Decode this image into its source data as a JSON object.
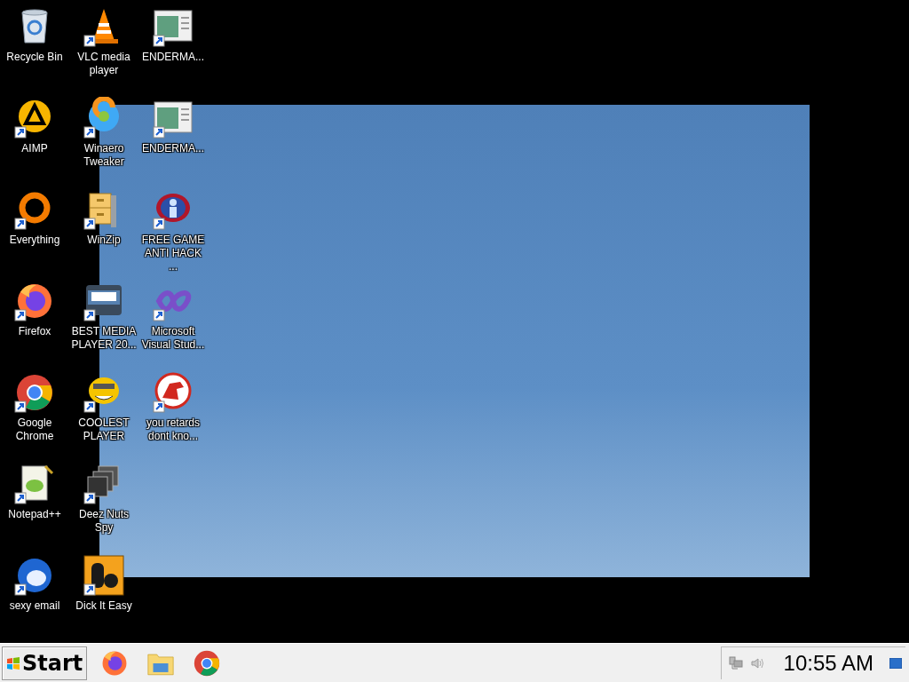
{
  "desktop": {
    "icons": [
      {
        "label": "Recycle Bin",
        "kind": "recycle",
        "shortcut": false
      },
      {
        "label": "AIMP",
        "kind": "aimp",
        "shortcut": true
      },
      {
        "label": "Everything",
        "kind": "ring",
        "shortcut": true
      },
      {
        "label": "Firefox",
        "kind": "firefox",
        "shortcut": true
      },
      {
        "label": "Google Chrome",
        "kind": "chrome",
        "shortcut": true
      },
      {
        "label": "Notepad++",
        "kind": "notepad",
        "shortcut": true
      },
      {
        "label": "sexy email",
        "kind": "bird",
        "shortcut": true
      },
      {
        "label": "VLC media player",
        "kind": "cone",
        "shortcut": true
      },
      {
        "label": "Winaero Tweaker",
        "kind": "swirl",
        "shortcut": true
      },
      {
        "label": "WinZip",
        "kind": "cabinet",
        "shortcut": true
      },
      {
        "label": "BEST MEDIA PLAYER 20...",
        "kind": "xm",
        "shortcut": true
      },
      {
        "label": "COOLEST PLAYER",
        "kind": "smiley",
        "shortcut": true
      },
      {
        "label": "Deez Nuts Spy",
        "kind": "stack",
        "shortcut": true
      },
      {
        "label": "Dick It Easy",
        "kind": "de",
        "shortcut": true
      },
      {
        "label": "ENDERMA...",
        "kind": "window",
        "shortcut": true
      },
      {
        "label": "ENDERMA...",
        "kind": "window",
        "shortcut": true
      },
      {
        "label": "FREE GAME ANTI HACK ...",
        "kind": "badge",
        "shortcut": true
      },
      {
        "label": "Microsoft Visual Stud...",
        "kind": "infinity",
        "shortcut": true
      },
      {
        "label": "you retards dont kno...",
        "kind": "dino",
        "shortcut": true
      }
    ]
  },
  "taskbar": {
    "start_label": "Start",
    "pinned": [
      {
        "kind": "firefox"
      },
      {
        "kind": "folder"
      },
      {
        "kind": "chrome"
      }
    ],
    "clock": "10:55 AM"
  }
}
